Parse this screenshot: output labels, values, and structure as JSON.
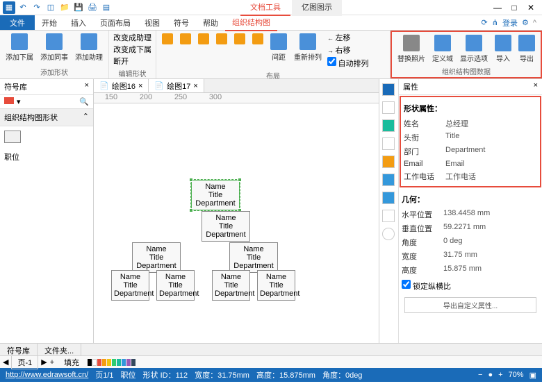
{
  "title_tabs": [
    "文档工具",
    "亿图图示"
  ],
  "menu": {
    "file": "文件",
    "items": [
      "开始",
      "插入",
      "页面布局",
      "视图",
      "符号",
      "帮助",
      "组织结构图"
    ],
    "login": "登录"
  },
  "ribbon": {
    "add_shape": {
      "label": "添加形状",
      "btns": [
        "添加下属",
        "添加同事",
        "添加助理"
      ]
    },
    "edit_shape": {
      "label": "编辑形状",
      "items": [
        "改变成助理",
        "改变成下属",
        "断开"
      ]
    },
    "layout": {
      "label": "布局",
      "space": "间距",
      "rearrange": "重新排列",
      "auto": "自动排列",
      "move": [
        "左移",
        "右移"
      ]
    },
    "data": {
      "label": "组织结构图数据",
      "btns": [
        "替换照片",
        "定义域",
        "显示选项",
        "导入",
        "导出"
      ]
    }
  },
  "sidebar": {
    "title": "符号库",
    "category": "组织结构图形状",
    "pos_label": "职位"
  },
  "doc_tabs": [
    "绘图16",
    "绘图17"
  ],
  "ruler_marks": [
    "150",
    "200",
    "250",
    "300"
  ],
  "org_template": {
    "name": "Name",
    "title": "Title",
    "dept": "Department"
  },
  "props": {
    "title": "属性",
    "shape_section": "形状属性：",
    "shape": [
      {
        "k": "姓名",
        "v": "总经理"
      },
      {
        "k": "头衔",
        "v": "Title"
      },
      {
        "k": "部门",
        "v": "Department"
      },
      {
        "k": "Email",
        "v": "Email"
      },
      {
        "k": "工作电话",
        "v": "工作电话"
      }
    ],
    "geom_section": "几何：",
    "geom": [
      {
        "k": "水平位置",
        "v": "138.4458 mm"
      },
      {
        "k": "垂直位置",
        "v": "59.2271 mm"
      },
      {
        "k": "角度",
        "v": "0 deg"
      },
      {
        "k": "宽度",
        "v": "31.75 mm"
      },
      {
        "k": "高度",
        "v": "15.875 mm"
      }
    ],
    "lock": "锁定纵横比",
    "export": "导出自定义属性..."
  },
  "bottom_tabs": [
    "符号库",
    "文件夹..."
  ],
  "page_bar": {
    "fill": "填充",
    "page": "页-1"
  },
  "status": {
    "url": "http://www.edrawsoft.cn/",
    "page": "页1/1",
    "pos": "职位",
    "shape_id": "形状 ID：112",
    "width": "宽度：31.75mm",
    "height": "高度：15.875mm",
    "angle": "角度：0deg",
    "zoom": "70%"
  },
  "colors": {
    "accent": "#e74c3c",
    "primary": "#1a6bb8"
  }
}
